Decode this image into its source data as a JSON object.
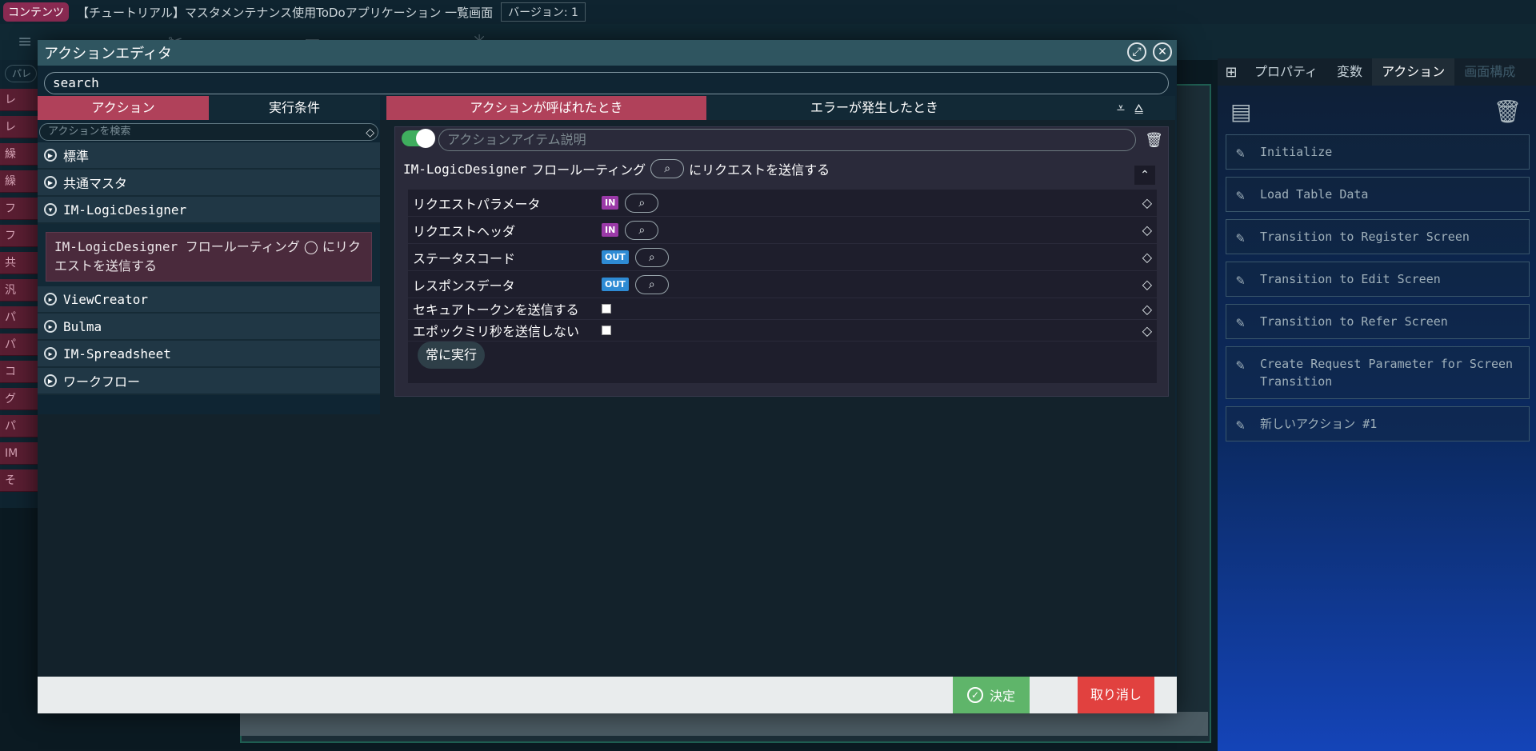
{
  "header": {
    "content_badge": "コンテンツ",
    "title": "【チュートリアル】マスタメンテナンス使用ToDoアプリケーション 一覧画面",
    "version": "バージョン: 1"
  },
  "palette": {
    "search_placeholder": "パレ",
    "items": [
      "レ",
      "レ",
      "繰",
      "繰",
      "フ",
      "フ",
      "共",
      "汎",
      "パ",
      "パ",
      "コ",
      "グ",
      "パ",
      "IM",
      "そ"
    ]
  },
  "right_panel": {
    "tabs": [
      "プロパティ",
      "変数",
      "アクション",
      "画面構成"
    ],
    "active_tab": "アクション",
    "actions": [
      "Initialize",
      "Load Table Data",
      "Transition to Register Screen",
      "Transition to Edit Screen",
      "Transition to Refer Screen",
      "Create Request Parameter for Screen Transition",
      "新しいアクション #1"
    ]
  },
  "modal": {
    "title": "アクションエディタ",
    "search_value": "search",
    "left_tabs": [
      "アクション",
      "実行条件"
    ],
    "left_search_placeholder": "アクションを検索",
    "categories": [
      {
        "label": "標準",
        "expanded": false
      },
      {
        "label": "共通マスタ",
        "expanded": false
      },
      {
        "label": "IM-LogicDesigner",
        "expanded": true
      },
      {
        "label": "ViewCreator",
        "expanded": false
      },
      {
        "label": "Bulma",
        "expanded": false
      },
      {
        "label": "IM-Spreadsheet",
        "expanded": false
      },
      {
        "label": "ワークフロー",
        "expanded": false
      }
    ],
    "sub_item_prefix": "IM-LogicDesigner フロールーティング",
    "sub_item_suffix": "にリクエストを送信する",
    "right_tabs": [
      "アクションが呼ばれたとき",
      "エラーが発生したとき"
    ],
    "card": {
      "description_placeholder": "アクションアイテム説明",
      "head_prefix": "IM-LogicDesigner",
      "head_middle": "フロールーティング",
      "head_suffix": "にリクエストを送信する",
      "params": [
        {
          "label": "リクエストパラメータ",
          "badge": "IN"
        },
        {
          "label": "リクエストヘッダ",
          "badge": "IN"
        },
        {
          "label": "ステータスコード",
          "badge": "OUT"
        },
        {
          "label": "レスポンスデータ",
          "badge": "OUT"
        }
      ],
      "checks": [
        {
          "label": "セキュアトークンを送信する"
        },
        {
          "label": "エポックミリ秒を送信しない"
        }
      ],
      "always_label": "常に実行"
    },
    "ok_label": "決定",
    "cancel_label": "取り消し"
  }
}
